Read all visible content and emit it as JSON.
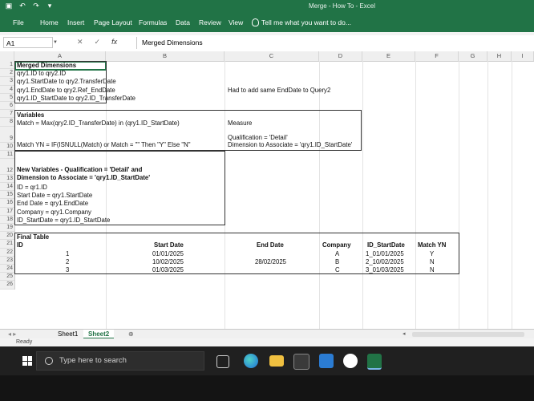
{
  "titlebar": {
    "document": "Merge - How To - Excel"
  },
  "ribbon_tabs": [
    "File",
    "Home",
    "Insert",
    "Page Layout",
    "Formulas",
    "Data",
    "Review",
    "View"
  ],
  "tell_me": "Tell me what you want to do...",
  "formula_bar": {
    "name_box": "A1",
    "fx": "fx",
    "value": "Merged Dimensions"
  },
  "columns": [
    "A",
    "B",
    "C",
    "D",
    "E",
    "F",
    "G",
    "H",
    "I"
  ],
  "rows": [
    "1",
    "2",
    "3",
    "4",
    "5",
    "6",
    "7",
    "8",
    "9",
    "10",
    "11",
    "12",
    "13",
    "14",
    "15",
    "16",
    "17",
    "18",
    "19",
    "20",
    "21",
    "22",
    "23",
    "24",
    "25",
    "26"
  ],
  "cells": {
    "r1a": "Merged Dimensions",
    "r2a": "qry1.ID to qry2.ID",
    "r3a": "qry1.StartDate to qry2.TransferDate",
    "r4a": "qry1.EndDate to qry2.Ref_EndDate",
    "r4c": "Had to add same EndDate to Query2",
    "r5a": "qry1.ID_StartDate to qry2.ID_TransferDate",
    "r7a": "Variables",
    "r8a": "Match = Max(qry2.ID_TransferDate) in (qry1.ID_StartDate)",
    "r8c": "Measure",
    "r9c1": "Qualification = 'Detail'",
    "r9a": "Match YN = IF(ISNULL(Match) or Match = \"\" Then \"Y\" Else \"N\"",
    "r9c2": "Dimension to Associate = 'qry1.ID_StartDate'",
    "r12a1": "New Variables - Qualification = 'Detail' and",
    "r12a2": "Dimension to Associate = 'qry1.ID_StartDate'",
    "r13a": "ID = qr1.ID",
    "r14a": "Start Date = qry1.StartDate",
    "r15a": "End Date = qry1.EndDate",
    "r16a": "Company = qry1.Company",
    "r17a": "ID_StartDate = qry1.ID_StartDate",
    "r19a": "Final Table"
  },
  "final_table": {
    "headers": {
      "id": "ID",
      "start": "Start Date",
      "end": "End Date",
      "company": "Company",
      "id_start": "ID_StartDate",
      "match": "Match YN"
    },
    "rows": [
      {
        "id": "1",
        "start": "01/01/2025",
        "end": "",
        "company": "A",
        "id_start": "1_01/01/2025",
        "match": "Y"
      },
      {
        "id": "2",
        "start": "10/02/2025",
        "end": "28/02/2025",
        "company": "B",
        "id_start": "2_10/02/2025",
        "match": "N"
      },
      {
        "id": "3",
        "start": "01/03/2025",
        "end": "",
        "company": "C",
        "id_start": "3_01/03/2025",
        "match": "N"
      }
    ]
  },
  "sheets": [
    "Sheet1",
    "Sheet2"
  ],
  "status": "Ready",
  "taskbar": {
    "search_placeholder": "Type here to search"
  },
  "colors": {
    "excel_green": "#217346",
    "taskbar": "#202020"
  }
}
